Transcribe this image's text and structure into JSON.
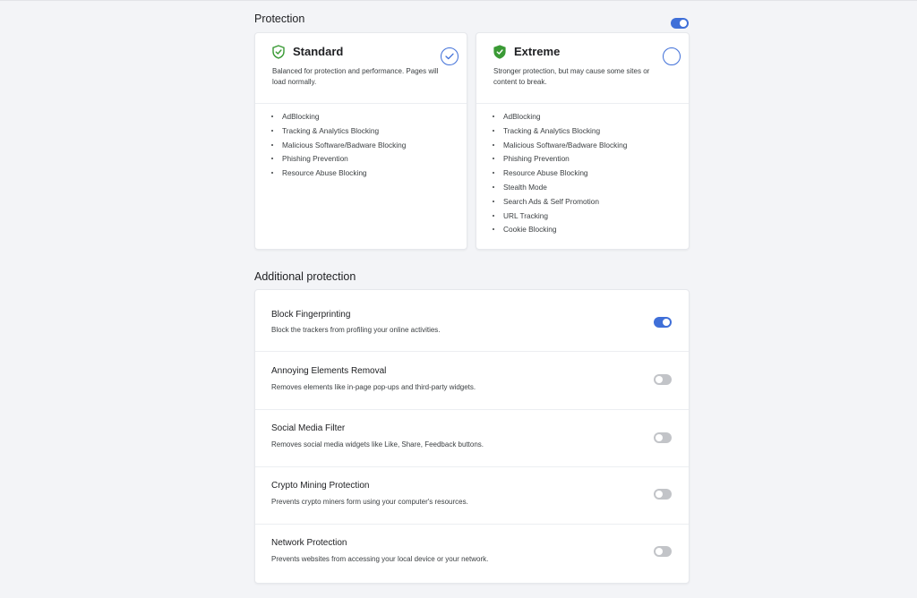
{
  "protection": {
    "title": "Protection",
    "enabled": true,
    "cards": [
      {
        "name": "Standard",
        "description": "Balanced for protection and performance. Pages will load normally.",
        "selected": true,
        "shield_style": "outline",
        "features": [
          "AdBlocking",
          "Tracking & Analytics Blocking",
          "Malicious Software/Badware Blocking",
          "Phishing Prevention",
          "Resource Abuse Blocking"
        ]
      },
      {
        "name": "Extreme",
        "description": "Stronger protection, but may cause some sites or content to break.",
        "selected": false,
        "shield_style": "filled",
        "features": [
          "AdBlocking",
          "Tracking & Analytics Blocking",
          "Malicious Software/Badware Blocking",
          "Phishing Prevention",
          "Resource Abuse Blocking",
          "Stealth Mode",
          "Search Ads & Self Promotion",
          "URL Tracking",
          "Cookie Blocking"
        ]
      }
    ]
  },
  "additional": {
    "title": "Additional protection",
    "items": [
      {
        "title": "Block Fingerprinting",
        "description": "Block the trackers from profiling your online activities.",
        "enabled": true
      },
      {
        "title": "Annoying Elements Removal",
        "description": "Removes elements like in-page pop-ups and third-party widgets.",
        "enabled": false
      },
      {
        "title": "Social Media Filter",
        "description": "Removes social media widgets like Like, Share, Feedback buttons.",
        "enabled": false
      },
      {
        "title": "Crypto Mining Protection",
        "description": "Prevents crypto miners form using your computer's resources.",
        "enabled": false
      },
      {
        "title": "Network Protection",
        "description": "Prevents websites from accessing your local device or your network.",
        "enabled": false
      }
    ]
  },
  "colors": {
    "accent": "#3f6fd8",
    "shield_green": "#3a9a35",
    "toggle_off": "#c2c4c8",
    "background": "#f3f4f7"
  },
  "icons": {
    "standard": "shield-outline-icon",
    "extreme": "shield-filled-icon",
    "selected": "check-icon"
  }
}
